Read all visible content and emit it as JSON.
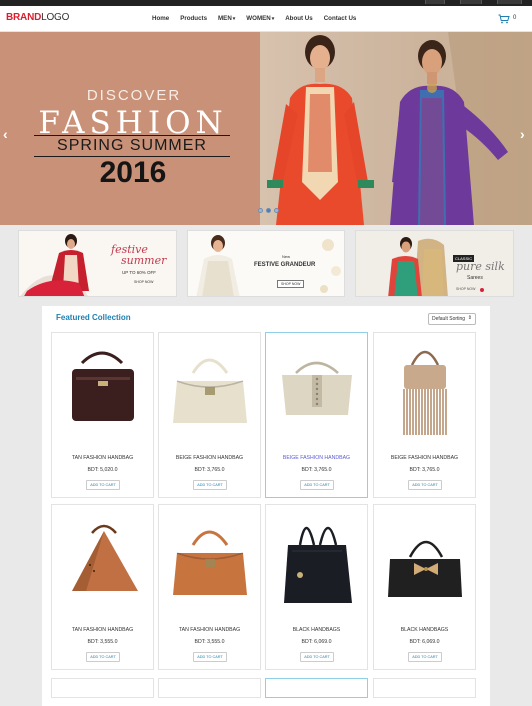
{
  "nav": {
    "brand": "BRAND",
    "logo_word": "LOGO",
    "menu": [
      {
        "label": "Home",
        "dropdown": false
      },
      {
        "label": "Products",
        "dropdown": false
      },
      {
        "label": "MEN",
        "dropdown": true
      },
      {
        "label": "WOMEN",
        "dropdown": true
      },
      {
        "label": "About Us",
        "dropdown": false
      },
      {
        "label": "Contact Us",
        "dropdown": false
      }
    ],
    "cart_count": "0",
    "caret": "▾"
  },
  "hero": {
    "discover": "DISCOVER",
    "fashion": "FASHION",
    "season": "SPRING SUMMER",
    "year": "2016",
    "prev": "‹",
    "next": "›",
    "slide_count": 3,
    "active_slide": 1
  },
  "promos": [
    {
      "script": "festive",
      "script2": "summer",
      "offer": "UP TO 60% OFF",
      "cta": "SHOP NOW"
    },
    {
      "eyebrow": "New",
      "title": "FESTIVE GRANDEUR",
      "cta": "SHOP NOW"
    },
    {
      "script": "pure silk",
      "sub": "Sarees",
      "eyebrow": "CLASSIC",
      "cta": "SHOP NOW"
    }
  ],
  "collection": {
    "title": "Featured Collection",
    "sort_label": "Default Sorting",
    "products": [
      {
        "name": "TAN FASHION HANDBAG",
        "price": "BDT: 5,020.0",
        "cta": "ADD TO CART",
        "selected": false,
        "color": "#3a1f1e",
        "style": "tote"
      },
      {
        "name": "BEIGE FASHION HANDBAG",
        "price": "BDT: 3,765.0",
        "cta": "ADD TO CART",
        "selected": false,
        "color": "#e6e0cc",
        "style": "satchel"
      },
      {
        "name": "BEIGE FASHION HANDBAG",
        "price": "BDT: 3,765.0",
        "cta": "ADD TO CART",
        "selected": true,
        "color": "#ddd6c3",
        "style": "studded"
      },
      {
        "name": "BEIGE FASHION HANDBAG",
        "price": "BDT: 3,765.0",
        "cta": "ADD TO CART",
        "selected": false,
        "color": "#c9a98c",
        "style": "fringe"
      },
      {
        "name": "TAN FASHION HANDBAG",
        "price": "BDT: 3,555.0",
        "cta": "ADD TO CART",
        "selected": false,
        "color": "#c07043",
        "style": "bucket"
      },
      {
        "name": "TAN FASHION HANDBAG",
        "price": "BDT: 3,555.0",
        "cta": "ADD TO CART",
        "selected": false,
        "color": "#c8743f",
        "style": "satchel"
      },
      {
        "name": "BLACK HANDBAGS",
        "price": "BDT: 6,069.0",
        "cta": "ADD TO CART",
        "selected": false,
        "color": "#1a1d24",
        "style": "tall"
      },
      {
        "name": "BLACK HANDBAGS",
        "price": "BDT: 6,069.0",
        "cta": "ADD TO CART",
        "selected": false,
        "color": "#202020",
        "style": "bow"
      }
    ]
  },
  "colors": {
    "brand_red": "#d71f2f",
    "accent_blue": "#1f7fb0",
    "hero_bg": "#c99177"
  }
}
